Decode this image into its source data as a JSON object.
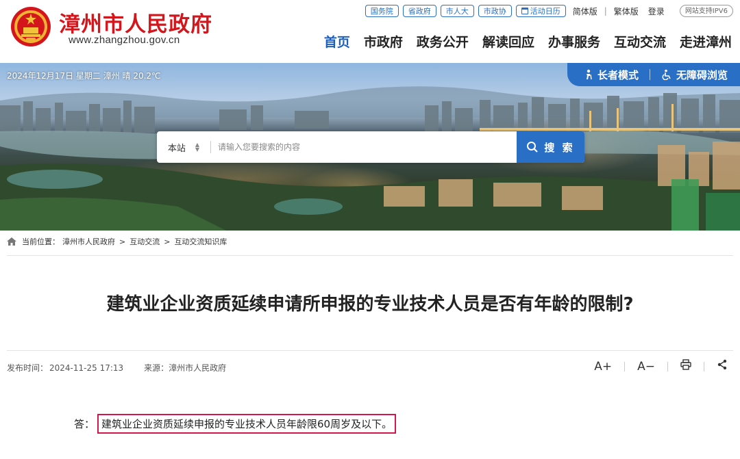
{
  "site": {
    "name": "漳州市人民政府",
    "url": "www.zhangzhou.gov.cn"
  },
  "toplinks": {
    "pills": [
      "国务院",
      "省政府",
      "市人大",
      "市政协"
    ],
    "calendar": "活动日历",
    "simplified": "简体版",
    "separator": "|",
    "traditional": "繁体版",
    "login": "登录",
    "ipv6": "网站支持IPV6"
  },
  "mainnav": [
    "首页",
    "市政府",
    "政务公开",
    "解读回应",
    "办事服务",
    "互动交流",
    "走进漳州"
  ],
  "banner": {
    "weather": "2024年12月17日 星期二  漳州 晴 20.2℃",
    "elder_mode": "长者模式",
    "accessible": "无障碍浏览"
  },
  "search": {
    "scope": "本站",
    "placeholder": "请输入您要搜索的内容",
    "button": "搜 索"
  },
  "breadcrumb": {
    "prefix": "当前位置：",
    "items": [
      "漳州市人民政府",
      "互动交流",
      "互动交流知识库"
    ],
    "sep": ">"
  },
  "article": {
    "title": "建筑业企业资质延续申请所申报的专业技术人员是否有年龄的限制?",
    "publish_label": "发布时间：",
    "publish_time": "2024-11-25 17:13",
    "source_label": "来源：",
    "source": "漳州市人民政府",
    "answer_label": "答：",
    "answer_text": "建筑业企业资质延续申报的专业技术人员年龄限60周岁及以下。"
  },
  "tools": {
    "font_up": "A+",
    "font_down": "A−"
  },
  "colors": {
    "brand_red": "#d4161c",
    "brand_blue": "#2a6fc6",
    "highlight": "#d4164f"
  }
}
